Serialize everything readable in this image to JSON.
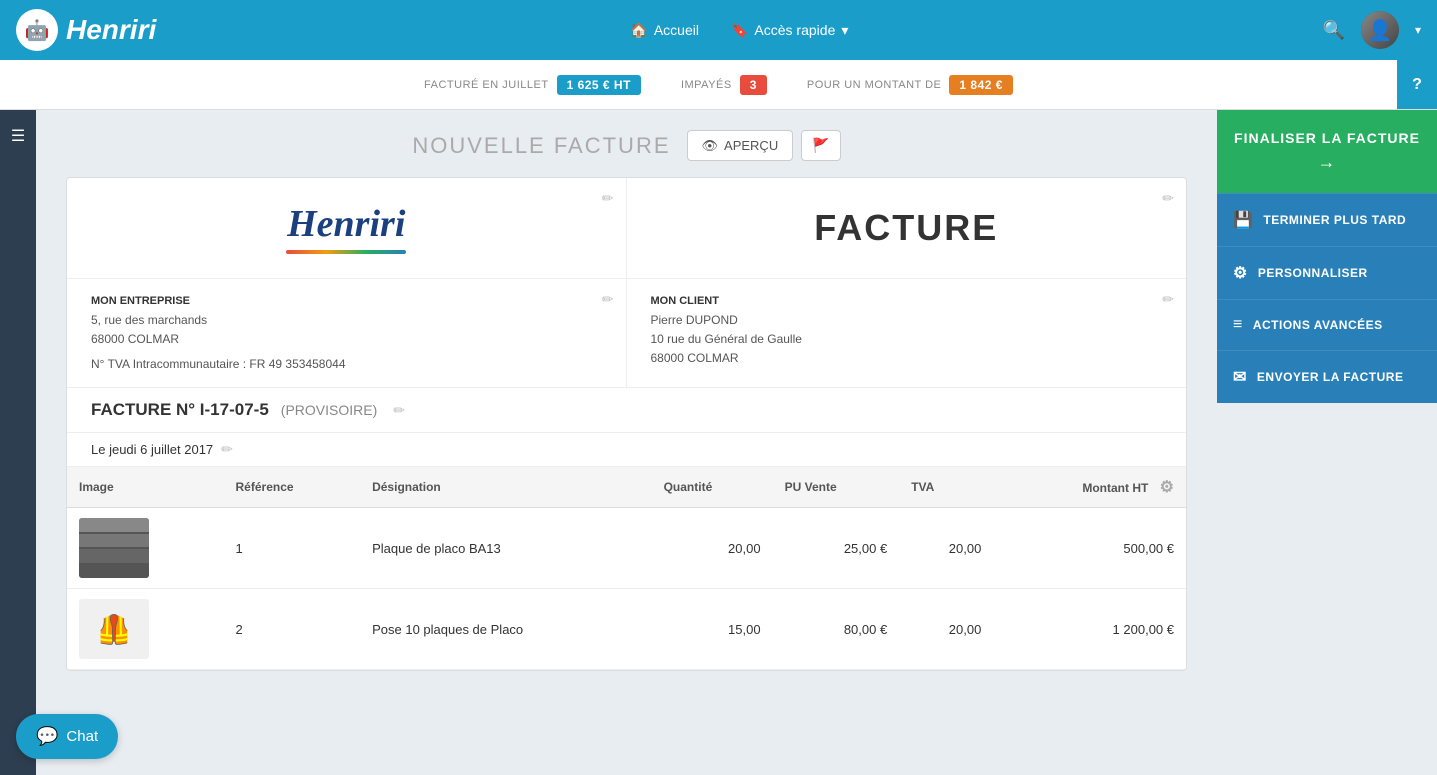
{
  "topnav": {
    "logo_text": "Henriri",
    "links": [
      {
        "label": "Accueil",
        "icon": "🏠"
      },
      {
        "label": "Accès rapide",
        "icon": "🔖",
        "has_dropdown": true
      }
    ],
    "search_icon": "🔍",
    "user_icon": "👤"
  },
  "infobar": {
    "facture_label": "FACTURÉ EN JUILLET",
    "facture_value": "1 625 € HT",
    "impayes_label": "IMPAYÉS",
    "impayes_count": "3",
    "montant_label": "POUR UN MONTANT DE",
    "montant_value": "1 842 €",
    "help_label": "?"
  },
  "page": {
    "title": "NOUVELLE FACTURE",
    "apercu_label": "APERÇU",
    "bookmark_icon": "🔖"
  },
  "invoice": {
    "header_title": "FACTURE",
    "company": {
      "name": "MON ENTREPRISE",
      "address_line1": "5, rue des marchands",
      "address_line2": "68000 COLMAR",
      "tva": "N° TVA Intracommunautaire : FR 49 353458044"
    },
    "client": {
      "label": "MON CLIENT",
      "name": "Pierre DUPOND",
      "address_line1": "10 rue du Général de Gaulle",
      "address_line2": "68000 COLMAR"
    },
    "number_label": "FACTURE N° I-17-07-5",
    "status": "(PROVISOIRE)",
    "date": "Le jeudi 6 juillet 2017",
    "table": {
      "columns": [
        "Image",
        "Référence",
        "Désignation",
        "Quantité",
        "PU Vente",
        "TVA",
        "Montant HT"
      ],
      "rows": [
        {
          "image_type": "placo",
          "reference": "1",
          "designation": "Plaque de placo BA13",
          "quantite": "20,00",
          "pu_vente": "25,00 €",
          "tva": "20,00",
          "montant_ht": "500,00 €"
        },
        {
          "image_type": "worker",
          "reference": "2",
          "designation": "Pose 10 plaques de Placo",
          "quantite": "15,00",
          "pu_vente": "80,00 €",
          "tva": "20,00",
          "montant_ht": "1 200,00 €"
        }
      ]
    }
  },
  "sidebar": {
    "finaliser_label": "FINALISER LA FACTURE",
    "finaliser_arrow": "→",
    "buttons": [
      {
        "label": "TERMINER PLUS TARD",
        "icon": "💾"
      },
      {
        "label": "PERSONNALISER",
        "icon": "⚙"
      },
      {
        "label": "ACTIONS AVANCÉES",
        "icon": "≡"
      },
      {
        "label": "ENVOYER LA FACTURE",
        "icon": "✉"
      }
    ]
  },
  "chat": {
    "label": "Chat",
    "icon": "💬"
  }
}
